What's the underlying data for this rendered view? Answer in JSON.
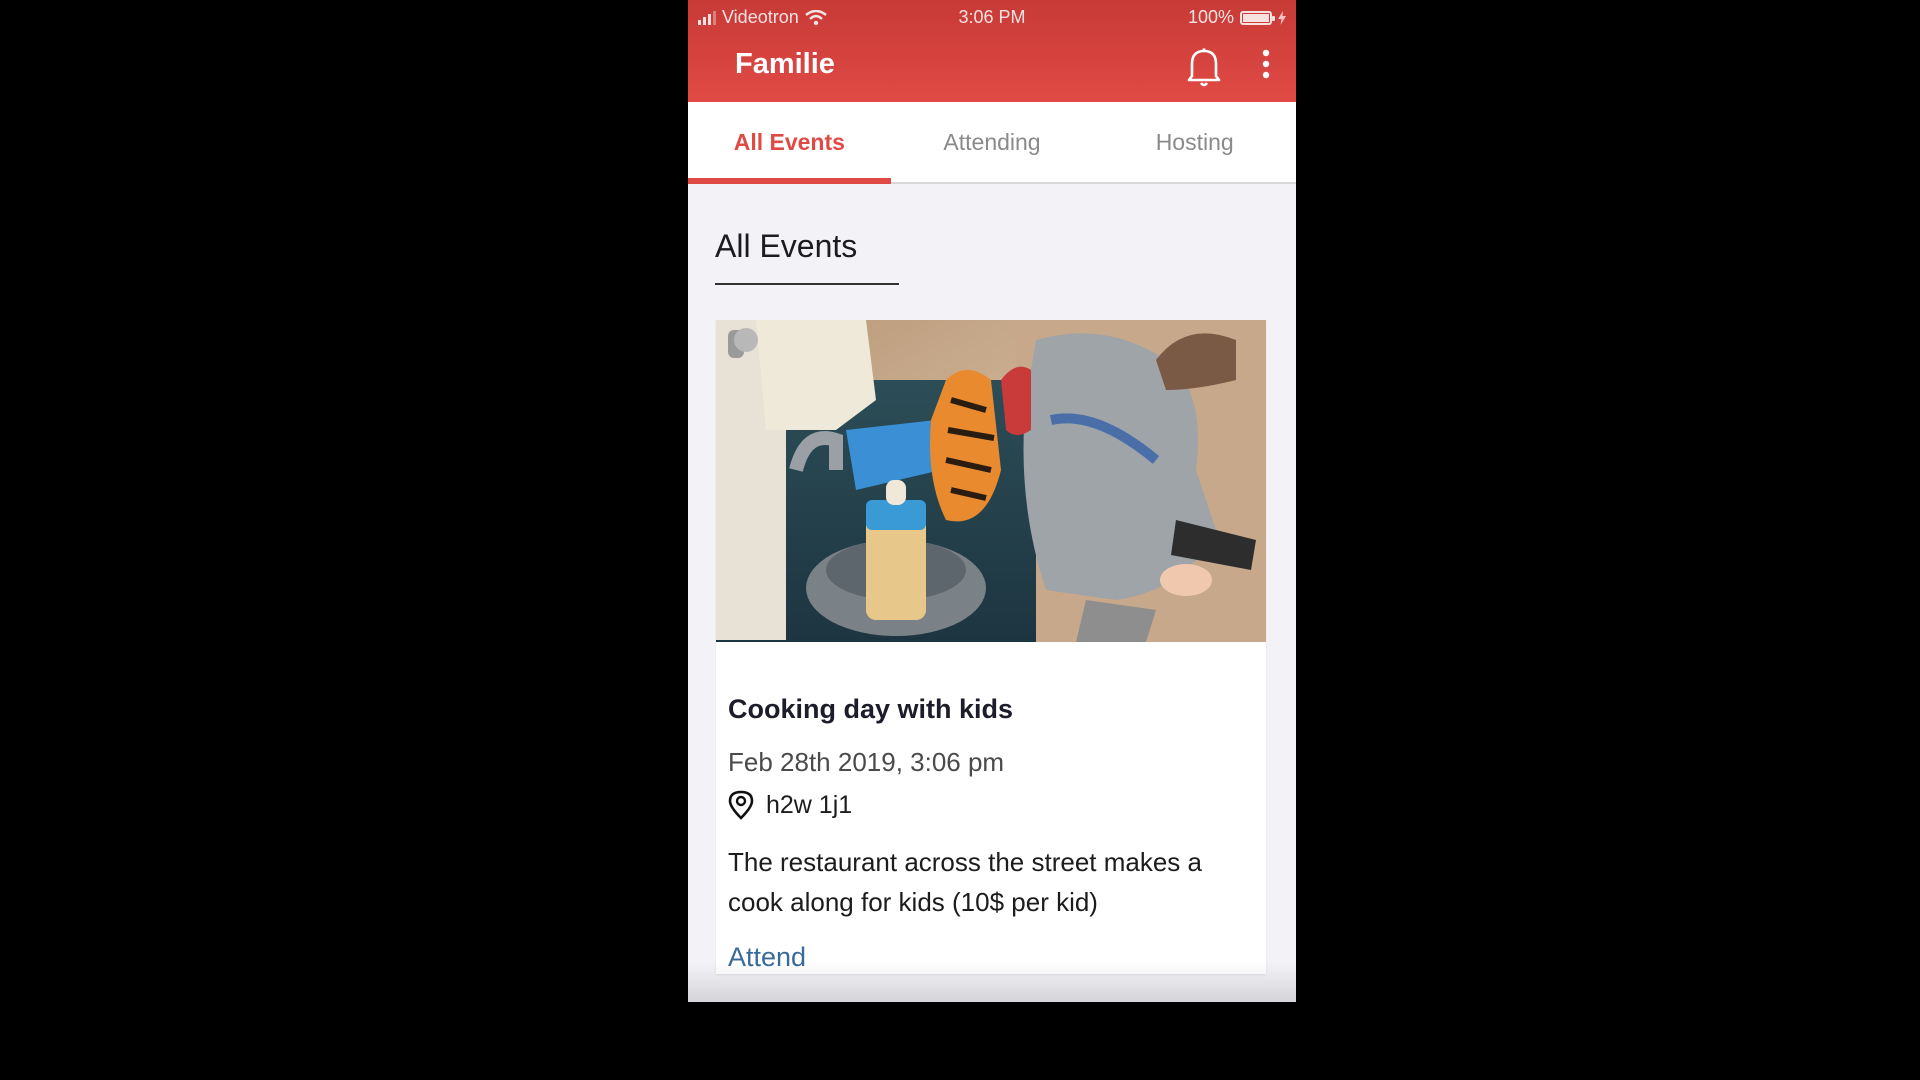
{
  "status_bar": {
    "carrier": "Videotron",
    "time": "3:06 PM",
    "battery": "100%"
  },
  "header": {
    "title": "Familie",
    "icons": [
      "bell-icon",
      "more-vertical-icon"
    ]
  },
  "tabs": [
    {
      "label": "All Events",
      "active": true
    },
    {
      "label": "Attending",
      "active": false
    },
    {
      "label": "Hosting",
      "active": false
    }
  ],
  "section": {
    "title": "All Events"
  },
  "event": {
    "title": "Cooking day with kids",
    "date": "Feb 28th 2019, 3:06 pm",
    "location": "h2w 1j1",
    "description": "The restaurant  across the street makes a cook along for kids (10$ per kid)",
    "attend_label": "Attend"
  },
  "colors": {
    "primary": "#e04a45",
    "header_dark": "#c73a36",
    "link": "#3a6a9a",
    "background": "#f2f2f7"
  }
}
